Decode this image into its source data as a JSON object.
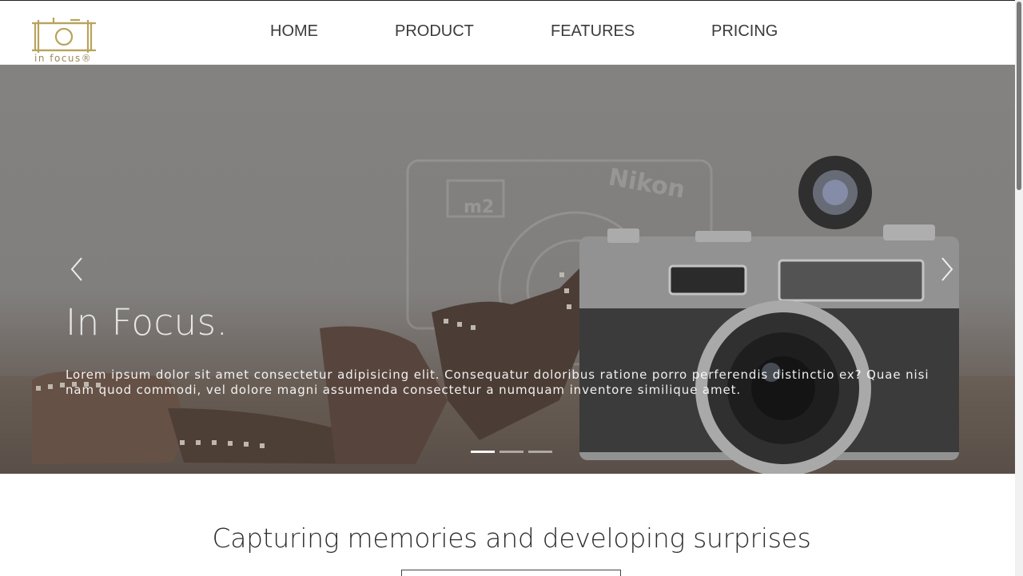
{
  "brand": {
    "name": "in focus®",
    "logo_color": "#b9a35d"
  },
  "nav": {
    "items": [
      {
        "label": "HOME"
      },
      {
        "label": "PRODUCT"
      },
      {
        "label": "FEATURES"
      },
      {
        "label": "PRICING"
      }
    ]
  },
  "hero": {
    "title": "In Focus.",
    "caption": "Lorem ipsum dolor sit amet consectetur adipisicing elit. Consequatur doloribus ratione porro perferendis distinctio ex? Quae nisi nam quod commodi, vel dolore magni assumenda consectetur a numquam inventore similique amet.",
    "prev_icon": "chevron-left-icon",
    "next_icon": "chevron-right-icon",
    "slides_count": 3,
    "active_slide": 1,
    "image_text": {
      "camera_brand": "Nikon",
      "camera_model": "m2"
    }
  },
  "section": {
    "heading": "Capturing memories and developing surprises"
  }
}
